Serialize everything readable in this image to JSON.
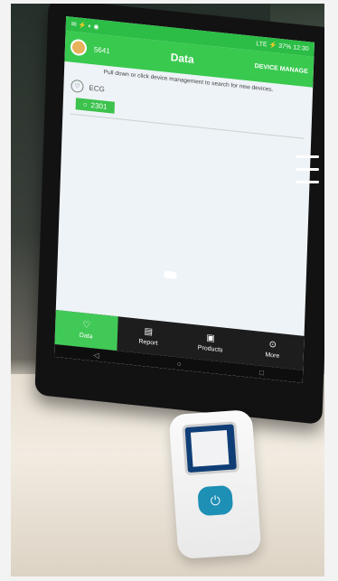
{
  "status_bar": {
    "left_icons": "✉ ⚡ ◐ ◉",
    "right": "LTE ⚡ 37% 12:30"
  },
  "app_bar": {
    "user": "5641",
    "title": "Data",
    "action": "DEVICE MANAGE"
  },
  "hint": "Pull down or click device management to search for new devices.",
  "device_list": {
    "section_label": "ECG",
    "device_id": "2301"
  },
  "bottom_tabs": [
    {
      "label": "Data",
      "icon": "heart-icon",
      "active": true
    },
    {
      "label": "Report",
      "icon": "report-icon",
      "active": false
    },
    {
      "label": "Products",
      "icon": "bag-icon",
      "active": false
    },
    {
      "label": "More",
      "icon": "more-icon",
      "active": false
    }
  ],
  "colors": {
    "accent": "#39c94f",
    "tab_active": "#41c957",
    "device_button": "#1e8fb5"
  }
}
